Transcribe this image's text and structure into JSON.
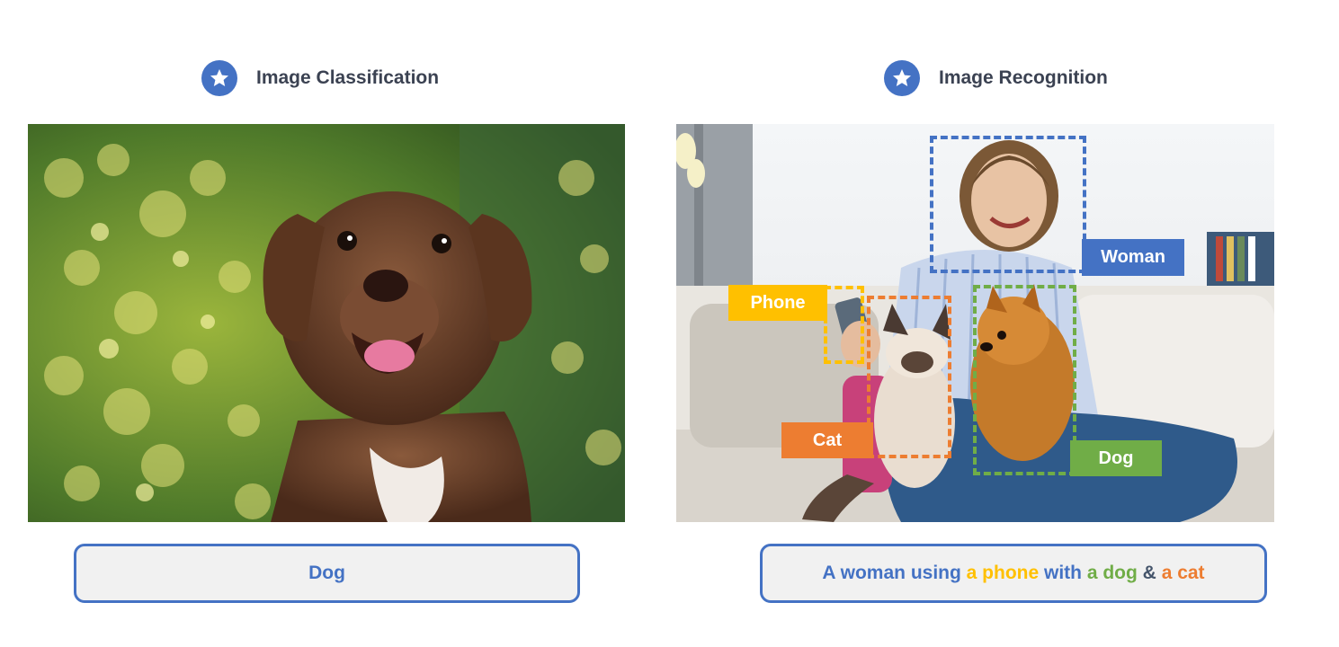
{
  "left_panel": {
    "title": "Image Classification",
    "icon": "star-icon",
    "caption": "Dog"
  },
  "right_panel": {
    "title": "Image Recognition",
    "icon": "star-icon",
    "caption_parts": [
      {
        "text": "A woman using ",
        "color": "#4472c4"
      },
      {
        "text": "a phone",
        "color": "#ffc000"
      },
      {
        "text": " with ",
        "color": "#4472c4"
      },
      {
        "text": "a dog",
        "color": "#70ad47"
      },
      {
        "text": " & ",
        "color": "#44546a"
      },
      {
        "text": "a cat",
        "color": "#ed7d31"
      }
    ],
    "labels": {
      "woman": "Woman",
      "phone": "Phone",
      "cat": "Cat",
      "dog": "Dog"
    }
  },
  "colors": {
    "accent_blue": "#4472c4",
    "phone_yellow": "#ffc000",
    "cat_orange": "#ed7d31",
    "dog_green": "#70ad47",
    "caption_bg": "#f1f1f1"
  }
}
